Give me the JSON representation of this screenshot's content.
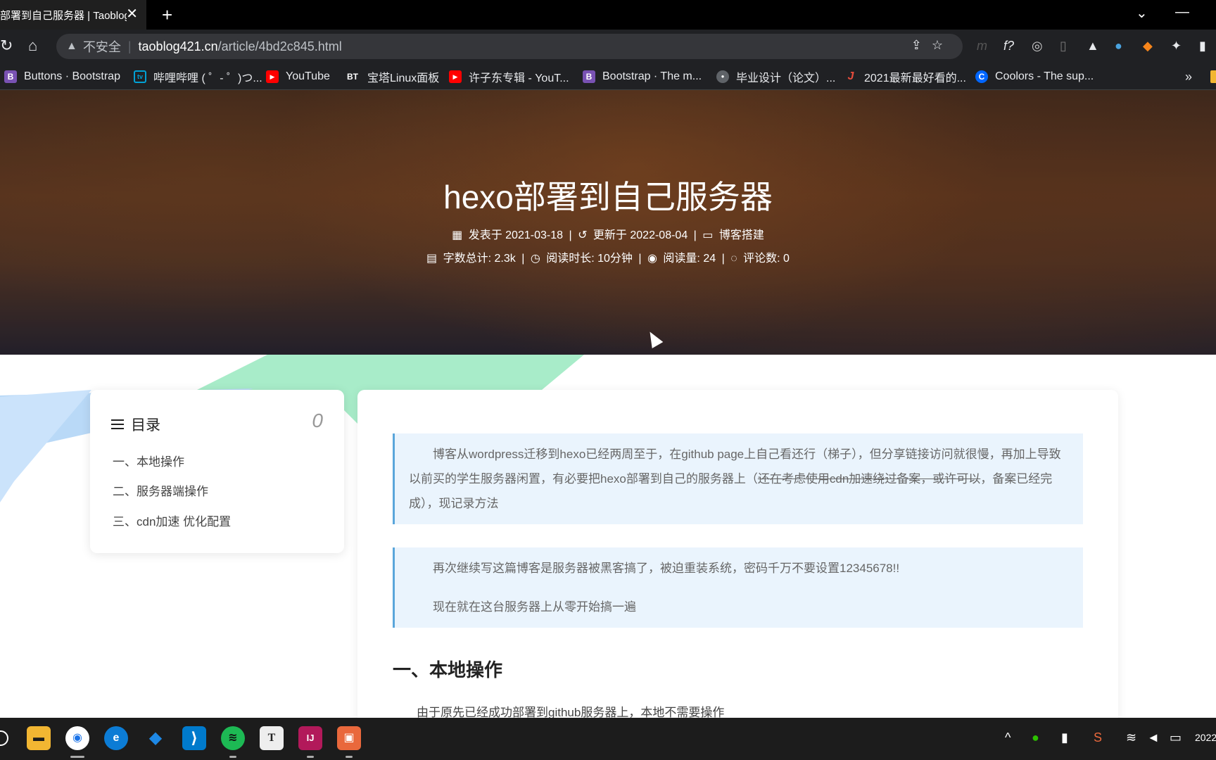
{
  "browser": {
    "tab_title": "部署到自己服务器 | Taoblog",
    "tab_close": "✕",
    "new_tab": "+",
    "win_min": "—",
    "win_chevron": "⌄",
    "insecure": "不安全",
    "url_host": "taoblog421.cn",
    "url_path": "/article/4bd2c845.html",
    "bookmarks_more": "»"
  },
  "bookmarks": [
    {
      "label": "Buttons · Bootstrap",
      "icon": "B",
      "color": "#7952b3"
    },
    {
      "label": "哔哩哔哩 ( ゜- ゜)つ...",
      "icon": "tv",
      "color": "#00a1d6"
    },
    {
      "label": "YouTube",
      "icon": "▶",
      "color": "#ff0000"
    },
    {
      "label": "宝塔Linux面板",
      "icon": "BT",
      "color": "#202124"
    },
    {
      "label": "许子东专辑 - YouT...",
      "icon": "▶",
      "color": "#ff0000"
    },
    {
      "label": "Bootstrap · The m...",
      "icon": "B",
      "color": "#7952b3"
    },
    {
      "label": "毕业设计（论文）...",
      "icon": "●",
      "color": "#5f6368"
    },
    {
      "label": "2021最新最好看的...",
      "icon": "J",
      "color": "#c0392b"
    },
    {
      "label": "Coolors - The sup...",
      "icon": "C",
      "color": "#0066ff"
    }
  ],
  "post": {
    "title": "hexo部署到自己服务器",
    "published": "发表于 2021-03-18",
    "updated": "更新于 2022-08-04",
    "category": "博客搭建",
    "sep": "|",
    "word_count": "字数总计: 2.3k",
    "read_time": "阅读时长: 10分钟",
    "views": "阅读量: 24",
    "comments": "评论数: 0"
  },
  "toc": {
    "title": "目录",
    "count": "0",
    "items": [
      "一、本地操作",
      "二、服务器端操作",
      "三、cdn加速 优化配置"
    ]
  },
  "article": {
    "note1_a": "博客从wordpress迁移到hexo已经两周至于，在github page上自己看还行（梯子），但分享链接访问就很慢，再加上导致以前买的学生服务器闲置，有必要把hexo部署到自己的服务器上（",
    "note1_strike": "还在考虑使用cdn加速绕过备案，或许可以",
    "note1_b": "，备案已经完成），现记录方法",
    "note2_line1": "再次继续写这篇博客是服务器被黑客搞了，被迫重装系统，密码千万不要设置12345678!!",
    "note2_line2": "现在就在这台服务器上从零开始搞一遍",
    "heading1": "一、本地操作",
    "para1": "由于原先已经成功部署到github服务器上，本地不需要操作"
  },
  "taskbar": {
    "apps": [
      {
        "name": "file-explorer",
        "glyph": "▬",
        "color": "#f2b632"
      },
      {
        "name": "chrome",
        "glyph": "◉",
        "color": "#1a73e8"
      },
      {
        "name": "edge",
        "glyph": "e",
        "color": "#0c7cd5"
      },
      {
        "name": "dolphin",
        "glyph": "◆",
        "color": "#1e88e5"
      },
      {
        "name": "vscode",
        "glyph": "⟩",
        "color": "#007acc"
      },
      {
        "name": "spotify",
        "glyph": "≋",
        "color": "#1db954"
      },
      {
        "name": "typora",
        "glyph": "T",
        "color": "#eeeeee"
      },
      {
        "name": "intellij",
        "glyph": "IJ",
        "color": "#b2195a"
      },
      {
        "name": "app",
        "glyph": "▣",
        "color": "#e9683c"
      }
    ],
    "clock": "2022"
  }
}
